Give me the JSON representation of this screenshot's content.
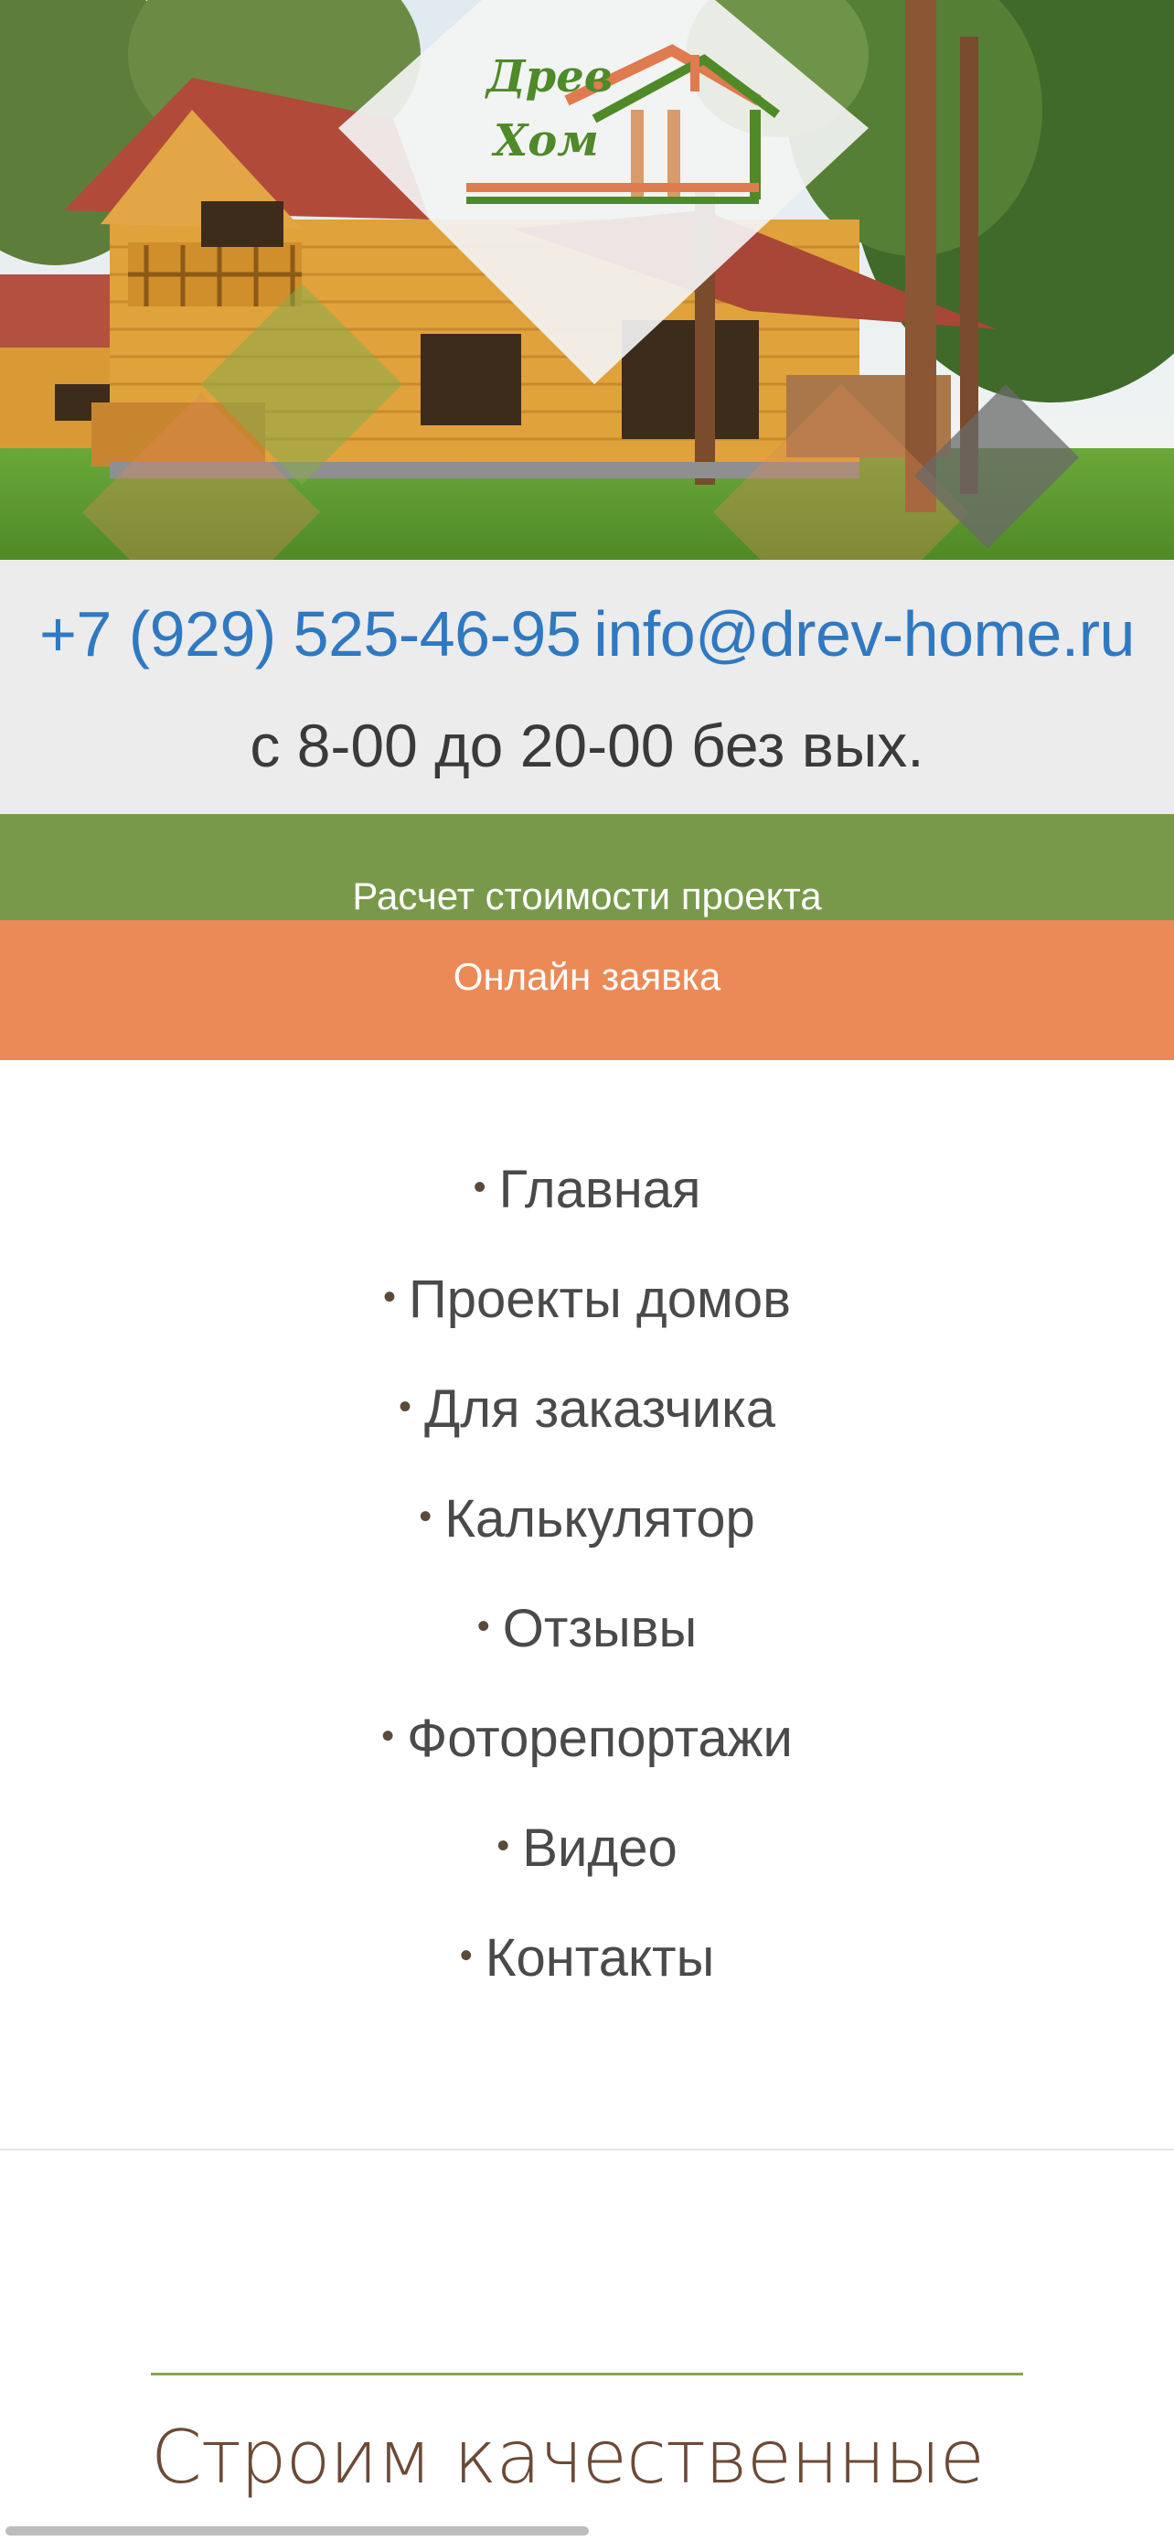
{
  "logo": {
    "line1": "Древ",
    "line2": "Хом"
  },
  "contacts": {
    "phone": "+7 (929) 525-46-95",
    "email": "info@drev-home.ru",
    "hours": "с 8-00 до 20-00 без вых."
  },
  "cta": {
    "calc_label": "Расчет стоимости проекта",
    "order_label": "Онлайн заявка"
  },
  "nav": {
    "bullet": "•",
    "items": [
      {
        "label": "Главная"
      },
      {
        "label": "Проекты домов"
      },
      {
        "label": "Для заказчика"
      },
      {
        "label": "Калькулятор"
      },
      {
        "label": "Отзывы"
      },
      {
        "label": "Фоторепортажи"
      },
      {
        "label": "Видео"
      },
      {
        "label": "Контакты"
      }
    ]
  },
  "section": {
    "title": "Строим качественные"
  },
  "colors": {
    "green": "#78994a",
    "orange": "#eb8a57",
    "link_blue": "#2f79c2",
    "heading_brown": "#6b4a36"
  }
}
